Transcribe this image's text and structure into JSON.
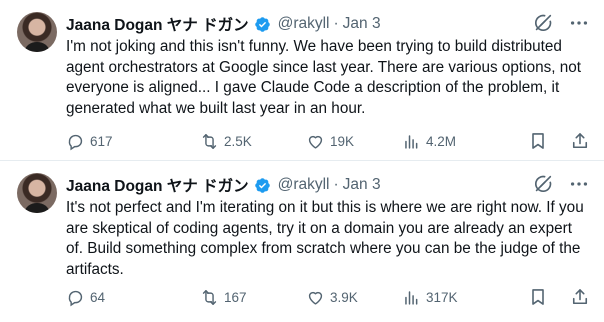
{
  "tweets": [
    {
      "author_name": "Jaana Dogan ヤナ ドガン",
      "handle": "@rakyll",
      "date": "Jan 3",
      "text": "I'm not joking and this isn't funny. We have been trying to build distributed agent orchestrators at Google since last year. There are various options, not everyone is aligned... I gave Claude Code a description of the problem, it generated what we built last year in an hour.",
      "replies": "617",
      "reposts": "2.5K",
      "likes": "19K",
      "views": "4.2M"
    },
    {
      "author_name": "Jaana Dogan ヤナ ドガン",
      "handle": "@rakyll",
      "date": "Jan 3",
      "text": "It's not perfect and I'm iterating on it but this is where we are right now. If you are skeptical of coding agents, try it on a domain you are already an expert of. Build something complex from scratch where you can be the judge of the artifacts.",
      "replies": "64",
      "reposts": "167",
      "likes": "3.9K",
      "views": "317K"
    }
  ],
  "separator": "·",
  "icons": {
    "verified": "verified-badge-icon",
    "grok": "grok-icon",
    "more": "more-icon",
    "reply": "reply-icon",
    "repost": "repost-icon",
    "like": "like-icon",
    "views": "views-icon",
    "bookmark": "bookmark-icon",
    "share": "share-icon"
  },
  "colors": {
    "verified": "#1d9bf0",
    "text": "#0f1419",
    "secondary": "#536471"
  }
}
